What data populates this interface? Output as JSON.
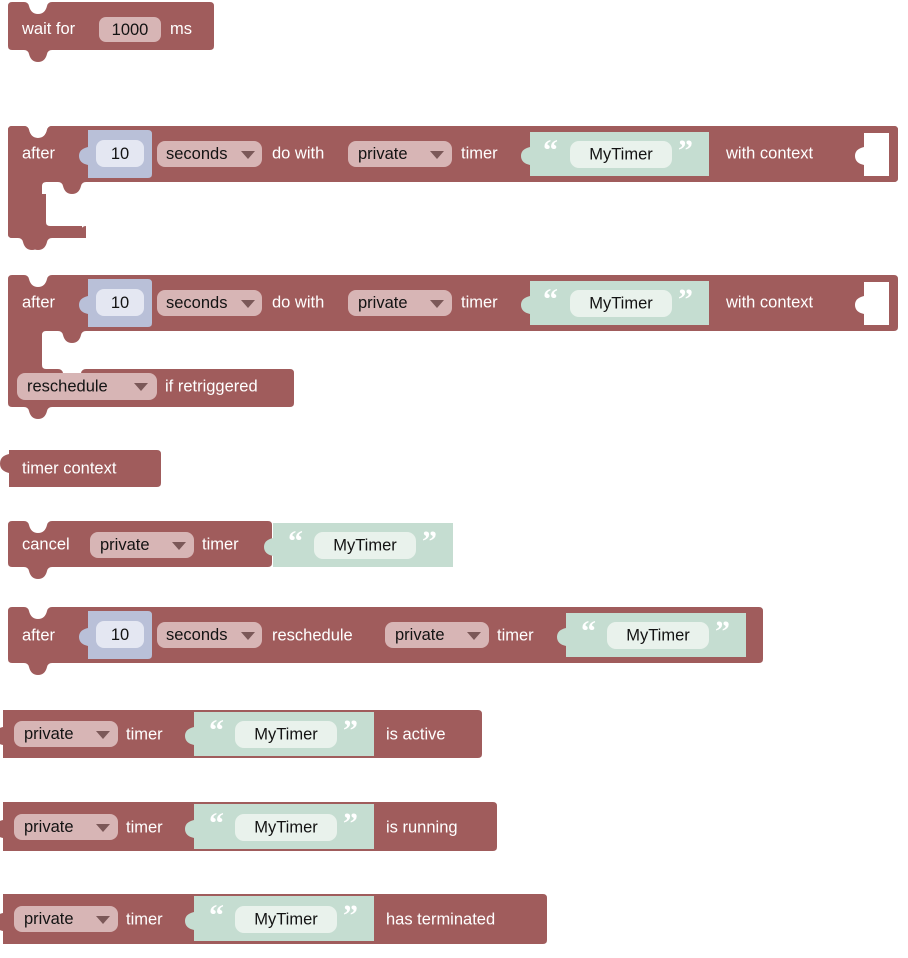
{
  "page": {
    "title": "Timer blocks palette",
    "background_color": "#ffffff"
  },
  "colors": {
    "block_body": "#a05c5c",
    "block_body_dark": "#8f4f4f",
    "field_dropdown": "#d7b5b5",
    "number_block": "#b9c0d8",
    "number_field": "#e4e7f2",
    "text_block": "#c5ddd1",
    "text_field": "#e9f2ec",
    "text_on_block": "#ffffff",
    "text_on_field": "#131313",
    "empty_socket": "#ffffff",
    "dropdown_arrow": "#5c3a3a"
  },
  "blocks": [
    {
      "id": "wait-for-ms",
      "name": "wait-for-block",
      "kind": "statement",
      "parts": [
        {
          "type": "label",
          "text": "wait for"
        },
        {
          "type": "field_number",
          "value": "1000"
        },
        {
          "type": "label",
          "text": "ms"
        }
      ]
    },
    {
      "id": "after-do-with-timer-context",
      "name": "after-do-with-timer-block",
      "kind": "c-statement",
      "parts": [
        {
          "type": "label",
          "text": "after"
        },
        {
          "type": "block_number",
          "value": "10"
        },
        {
          "type": "field_dropdown",
          "value": "seconds"
        },
        {
          "type": "label",
          "text": "do with"
        },
        {
          "type": "field_dropdown",
          "value": "private"
        },
        {
          "type": "label",
          "text": "timer"
        },
        {
          "type": "block_text",
          "value": "MyTimer"
        },
        {
          "type": "label",
          "text": "with context"
        },
        {
          "type": "empty_socket"
        }
      ]
    },
    {
      "id": "after-do-with-timer-reschedule",
      "name": "after-do-with-timer-reschedule-block",
      "kind": "c-statement-footer",
      "parts": [
        {
          "type": "label",
          "text": "after"
        },
        {
          "type": "block_number",
          "value": "10"
        },
        {
          "type": "field_dropdown",
          "value": "seconds"
        },
        {
          "type": "label",
          "text": "do with"
        },
        {
          "type": "field_dropdown",
          "value": "private"
        },
        {
          "type": "label",
          "text": "timer"
        },
        {
          "type": "block_text",
          "value": "MyTimer"
        },
        {
          "type": "label",
          "text": "with context"
        },
        {
          "type": "empty_socket"
        }
      ],
      "footer_parts": [
        {
          "type": "field_dropdown",
          "value": "reschedule"
        },
        {
          "type": "label",
          "text": "if retriggered"
        }
      ]
    },
    {
      "id": "timer-context",
      "name": "timer-context-block",
      "kind": "value",
      "parts": [
        {
          "type": "label",
          "text": "timer context"
        }
      ]
    },
    {
      "id": "cancel-timer",
      "name": "cancel-timer-block",
      "kind": "statement",
      "parts": [
        {
          "type": "label",
          "text": "cancel"
        },
        {
          "type": "field_dropdown",
          "value": "private"
        },
        {
          "type": "label",
          "text": "timer"
        },
        {
          "type": "block_text",
          "value": "MyTimer"
        }
      ]
    },
    {
      "id": "after-reschedule-timer",
      "name": "after-reschedule-timer-block",
      "kind": "statement",
      "parts": [
        {
          "type": "label",
          "text": "after"
        },
        {
          "type": "block_number",
          "value": "10"
        },
        {
          "type": "field_dropdown",
          "value": "seconds"
        },
        {
          "type": "label",
          "text": "reschedule"
        },
        {
          "type": "field_dropdown",
          "value": "private"
        },
        {
          "type": "label",
          "text": "timer"
        },
        {
          "type": "block_text",
          "value": "MyTimer"
        }
      ]
    },
    {
      "id": "timer-is-active",
      "name": "timer-is-active-block",
      "kind": "value",
      "parts": [
        {
          "type": "field_dropdown",
          "value": "private"
        },
        {
          "type": "label",
          "text": "timer"
        },
        {
          "type": "block_text",
          "value": "MyTimer"
        },
        {
          "type": "label",
          "text": "is active"
        }
      ]
    },
    {
      "id": "timer-is-running",
      "name": "timer-is-running-block",
      "kind": "value",
      "parts": [
        {
          "type": "field_dropdown",
          "value": "private"
        },
        {
          "type": "label",
          "text": "timer"
        },
        {
          "type": "block_text",
          "value": "MyTimer"
        },
        {
          "type": "label",
          "text": "is running"
        }
      ]
    },
    {
      "id": "timer-has-terminated",
      "name": "timer-has-terminated-block",
      "kind": "value",
      "parts": [
        {
          "type": "field_dropdown",
          "value": "private"
        },
        {
          "type": "label",
          "text": "timer"
        },
        {
          "type": "block_text",
          "value": "MyTimer"
        },
        {
          "type": "label",
          "text": "has terminated"
        }
      ]
    }
  ],
  "labels": {
    "wait_for": "wait for",
    "ms": "ms",
    "after": "after",
    "do_with": "do with",
    "timer": "timer",
    "with_context": "with context",
    "if_retriggered": "if retriggered",
    "timer_context": "timer context",
    "cancel": "cancel",
    "reschedule": "reschedule",
    "is_active": "is active",
    "is_running": "is running",
    "has_terminated": "has terminated"
  },
  "values": {
    "ms_1000": "1000",
    "num_10": "10",
    "seconds": "seconds",
    "private": "private",
    "mytimer": "MyTimer",
    "reschedule": "reschedule"
  }
}
